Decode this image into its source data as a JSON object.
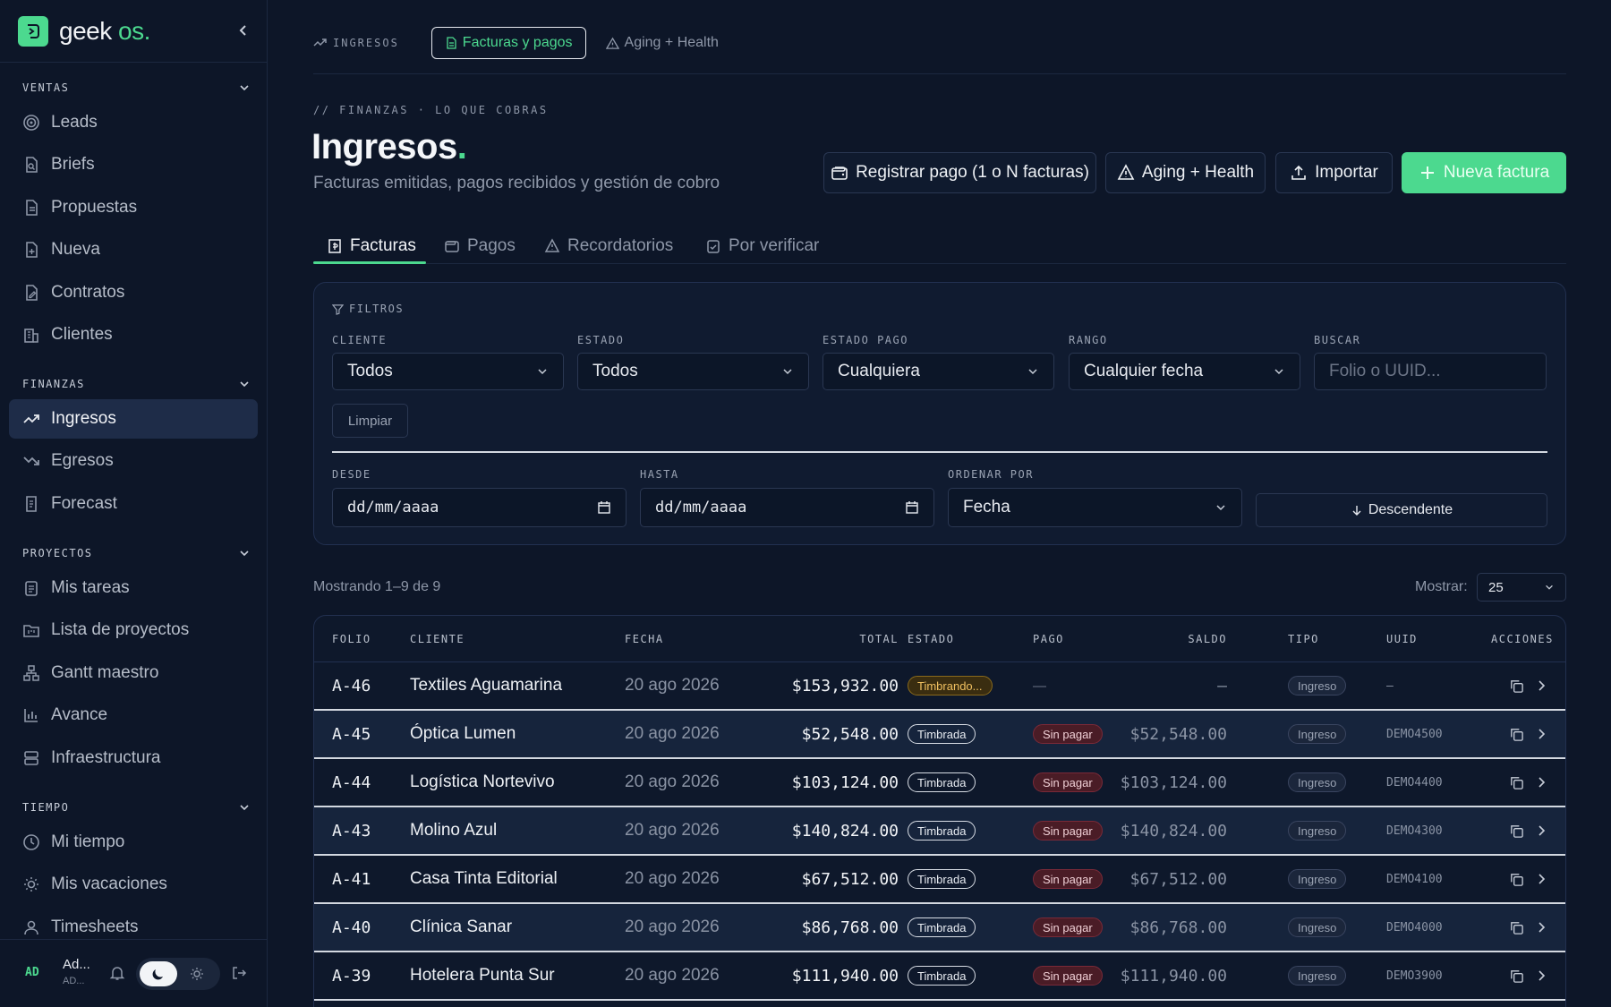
{
  "brand": {
    "name": "geek",
    "suffix": "os",
    "dot": "."
  },
  "sidebar": {
    "sections": [
      {
        "title": "VENTAS",
        "items": [
          "Leads",
          "Briefs",
          "Propuestas",
          "Nueva",
          "Contratos",
          "Clientes"
        ]
      },
      {
        "title": "FINANZAS",
        "items": [
          "Ingresos",
          "Egresos",
          "Forecast"
        ]
      },
      {
        "title": "PROYECTOS",
        "items": [
          "Mis tareas",
          "Lista de proyectos",
          "Gantt maestro",
          "Avance",
          "Infraestructura"
        ]
      },
      {
        "title": "TIEMPO",
        "items": [
          "Mi tiempo",
          "Mis vacaciones",
          "Timesheets"
        ]
      }
    ],
    "active_item": "Ingresos",
    "user": {
      "initials": "AD",
      "name": "Ad...",
      "sub": "AD..."
    }
  },
  "topbar": {
    "section": "INGRESOS",
    "links": [
      "Facturas y pagos",
      "Aging + Health"
    ],
    "active_link": "Facturas y pagos"
  },
  "header": {
    "eyebrow": "// FINANZAS · LO QUE COBRAS",
    "title": "Ingresos",
    "title_dot": ".",
    "subtitle": "Facturas emitidas, pagos recibidos y gestión de cobro",
    "actions": {
      "register_payment": "Registrar pago (1 o N facturas)",
      "aging": "Aging + Health",
      "import": "Importar",
      "new_invoice": "Nueva factura"
    }
  },
  "tabs": [
    "Facturas",
    "Pagos",
    "Recordatorios",
    "Por verificar"
  ],
  "active_tab": "Facturas",
  "filters": {
    "title": "FILTROS",
    "cliente": {
      "label": "CLIENTE",
      "value": "Todos"
    },
    "estado": {
      "label": "ESTADO",
      "value": "Todos"
    },
    "estado_pago": {
      "label": "ESTADO PAGO",
      "value": "Cualquiera"
    },
    "rango": {
      "label": "RANGO",
      "value": "Cualquier fecha"
    },
    "buscar": {
      "label": "BUSCAR",
      "placeholder": "Folio o UUID..."
    },
    "clear": "Limpiar",
    "desde": {
      "label": "DESDE",
      "placeholder": "dd/mm/aaaa"
    },
    "hasta": {
      "label": "HASTA",
      "placeholder": "dd/mm/aaaa"
    },
    "ordenar": {
      "label": "ORDENAR POR",
      "value": "Fecha"
    },
    "direction": "Descendente"
  },
  "results": {
    "summary": "Mostrando 1–9 de 9",
    "show_label": "Mostrar:",
    "show_value": "25"
  },
  "table": {
    "columns": [
      "FOLIO",
      "CLIENTE",
      "FECHA",
      "TOTAL",
      "ESTADO",
      "PAGO",
      "SALDO",
      "TIPO",
      "UUID",
      "ACCIONES"
    ],
    "rows": [
      {
        "folio": "A-46",
        "cliente": "Textiles Aguamarina",
        "fecha": "20 ago 2026",
        "total": "$153,932.00",
        "estado": "Timbrando...",
        "pago": "—",
        "saldo": "—",
        "tipo": "Ingreso",
        "uuid": "—"
      },
      {
        "folio": "A-45",
        "cliente": "Óptica Lumen",
        "fecha": "20 ago 2026",
        "total": "$52,548.00",
        "estado": "Timbrada",
        "pago": "Sin pagar",
        "saldo": "$52,548.00",
        "tipo": "Ingreso",
        "uuid": "DEMO4500"
      },
      {
        "folio": "A-44",
        "cliente": "Logística Nortevivo",
        "fecha": "20 ago 2026",
        "total": "$103,124.00",
        "estado": "Timbrada",
        "pago": "Sin pagar",
        "saldo": "$103,124.00",
        "tipo": "Ingreso",
        "uuid": "DEMO4400"
      },
      {
        "folio": "A-43",
        "cliente": "Molino Azul",
        "fecha": "20 ago 2026",
        "total": "$140,824.00",
        "estado": "Timbrada",
        "pago": "Sin pagar",
        "saldo": "$140,824.00",
        "tipo": "Ingreso",
        "uuid": "DEMO4300"
      },
      {
        "folio": "A-41",
        "cliente": "Casa Tinta Editorial",
        "fecha": "20 ago 2026",
        "total": "$67,512.00",
        "estado": "Timbrada",
        "pago": "Sin pagar",
        "saldo": "$67,512.00",
        "tipo": "Ingreso",
        "uuid": "DEMO4100"
      },
      {
        "folio": "A-40",
        "cliente": "Clínica Sanar",
        "fecha": "20 ago 2026",
        "total": "$86,768.00",
        "estado": "Timbrada",
        "pago": "Sin pagar",
        "saldo": "$86,768.00",
        "tipo": "Ingreso",
        "uuid": "DEMO4000"
      },
      {
        "folio": "A-39",
        "cliente": "Hotelera Punta Sur",
        "fecha": "20 ago 2026",
        "total": "$111,940.00",
        "estado": "Timbrada",
        "pago": "Sin pagar",
        "saldo": "$111,940.00",
        "tipo": "Ingreso",
        "uuid": "DEMO3900"
      }
    ]
  },
  "colors": {
    "accent": "#4cd98f",
    "background": "#0d1628",
    "danger": "#4a1c26",
    "warning": "#f0c060"
  }
}
